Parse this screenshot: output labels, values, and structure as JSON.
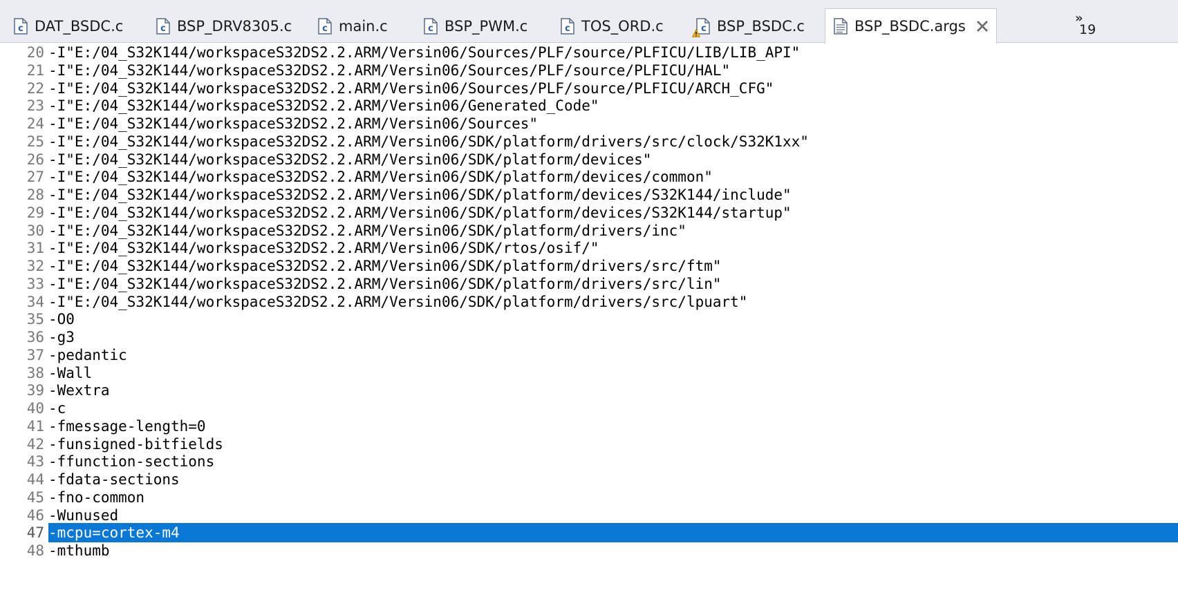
{
  "tabs": [
    {
      "label": "DAT_BSDC.c",
      "icon": "c-file-icon",
      "warning": false,
      "active": false
    },
    {
      "label": "BSP_DRV8305.c",
      "icon": "c-file-icon",
      "warning": false,
      "active": false
    },
    {
      "label": "main.c",
      "icon": "c-file-icon",
      "warning": false,
      "active": false
    },
    {
      "label": "BSP_PWM.c",
      "icon": "c-file-icon",
      "warning": false,
      "active": false
    },
    {
      "label": "TOS_ORD.c",
      "icon": "c-file-icon",
      "warning": false,
      "active": false
    },
    {
      "label": "BSP_BSDC.c",
      "icon": "c-file-warning-icon",
      "warning": true,
      "active": false
    },
    {
      "label": "BSP_BSDC.args",
      "icon": "text-file-icon",
      "warning": false,
      "active": true
    }
  ],
  "overflow": {
    "chevron": "»",
    "count": "19"
  },
  "editor": {
    "lines": [
      {
        "n": "20",
        "text": "-I\"E:/04_S32K144/workspaceS32DS2.2.ARM/Versin06/Sources/PLF/source/PLFICU/LIB/LIB_API\""
      },
      {
        "n": "21",
        "text": "-I\"E:/04_S32K144/workspaceS32DS2.2.ARM/Versin06/Sources/PLF/source/PLFICU/HAL\""
      },
      {
        "n": "22",
        "text": "-I\"E:/04_S32K144/workspaceS32DS2.2.ARM/Versin06/Sources/PLF/source/PLFICU/ARCH_CFG\""
      },
      {
        "n": "23",
        "text": "-I\"E:/04_S32K144/workspaceS32DS2.2.ARM/Versin06/Generated_Code\""
      },
      {
        "n": "24",
        "text": "-I\"E:/04_S32K144/workspaceS32DS2.2.ARM/Versin06/Sources\""
      },
      {
        "n": "25",
        "text": "-I\"E:/04_S32K144/workspaceS32DS2.2.ARM/Versin06/SDK/platform/drivers/src/clock/S32K1xx\""
      },
      {
        "n": "26",
        "text": "-I\"E:/04_S32K144/workspaceS32DS2.2.ARM/Versin06/SDK/platform/devices\""
      },
      {
        "n": "27",
        "text": "-I\"E:/04_S32K144/workspaceS32DS2.2.ARM/Versin06/SDK/platform/devices/common\""
      },
      {
        "n": "28",
        "text": "-I\"E:/04_S32K144/workspaceS32DS2.2.ARM/Versin06/SDK/platform/devices/S32K144/include\""
      },
      {
        "n": "29",
        "text": "-I\"E:/04_S32K144/workspaceS32DS2.2.ARM/Versin06/SDK/platform/devices/S32K144/startup\""
      },
      {
        "n": "30",
        "text": "-I\"E:/04_S32K144/workspaceS32DS2.2.ARM/Versin06/SDK/platform/drivers/inc\""
      },
      {
        "n": "31",
        "text": "-I\"E:/04_S32K144/workspaceS32DS2.2.ARM/Versin06/SDK/rtos/osif/\""
      },
      {
        "n": "32",
        "text": "-I\"E:/04_S32K144/workspaceS32DS2.2.ARM/Versin06/SDK/platform/drivers/src/ftm\""
      },
      {
        "n": "33",
        "text": "-I\"E:/04_S32K144/workspaceS32DS2.2.ARM/Versin06/SDK/platform/drivers/src/lin\""
      },
      {
        "n": "34",
        "text": "-I\"E:/04_S32K144/workspaceS32DS2.2.ARM/Versin06/SDK/platform/drivers/src/lpuart\""
      },
      {
        "n": "35",
        "text": "-O0"
      },
      {
        "n": "36",
        "text": "-g3"
      },
      {
        "n": "37",
        "text": "-pedantic"
      },
      {
        "n": "38",
        "text": "-Wall"
      },
      {
        "n": "39",
        "text": "-Wextra"
      },
      {
        "n": "40",
        "text": "-c"
      },
      {
        "n": "41",
        "text": "-fmessage-length=0"
      },
      {
        "n": "42",
        "text": "-funsigned-bitfields"
      },
      {
        "n": "43",
        "text": "-ffunction-sections"
      },
      {
        "n": "44",
        "text": "-fdata-sections"
      },
      {
        "n": "45",
        "text": "-fno-common"
      },
      {
        "n": "46",
        "text": "-Wunused"
      },
      {
        "n": "47",
        "text": "-mcpu=cortex-m4",
        "selected": true
      },
      {
        "n": "48",
        "text": "-mthumb"
      }
    ]
  },
  "colors": {
    "selection": "#0a78d7",
    "line_number": "#787878",
    "tab_bar": "#ebedf2"
  }
}
